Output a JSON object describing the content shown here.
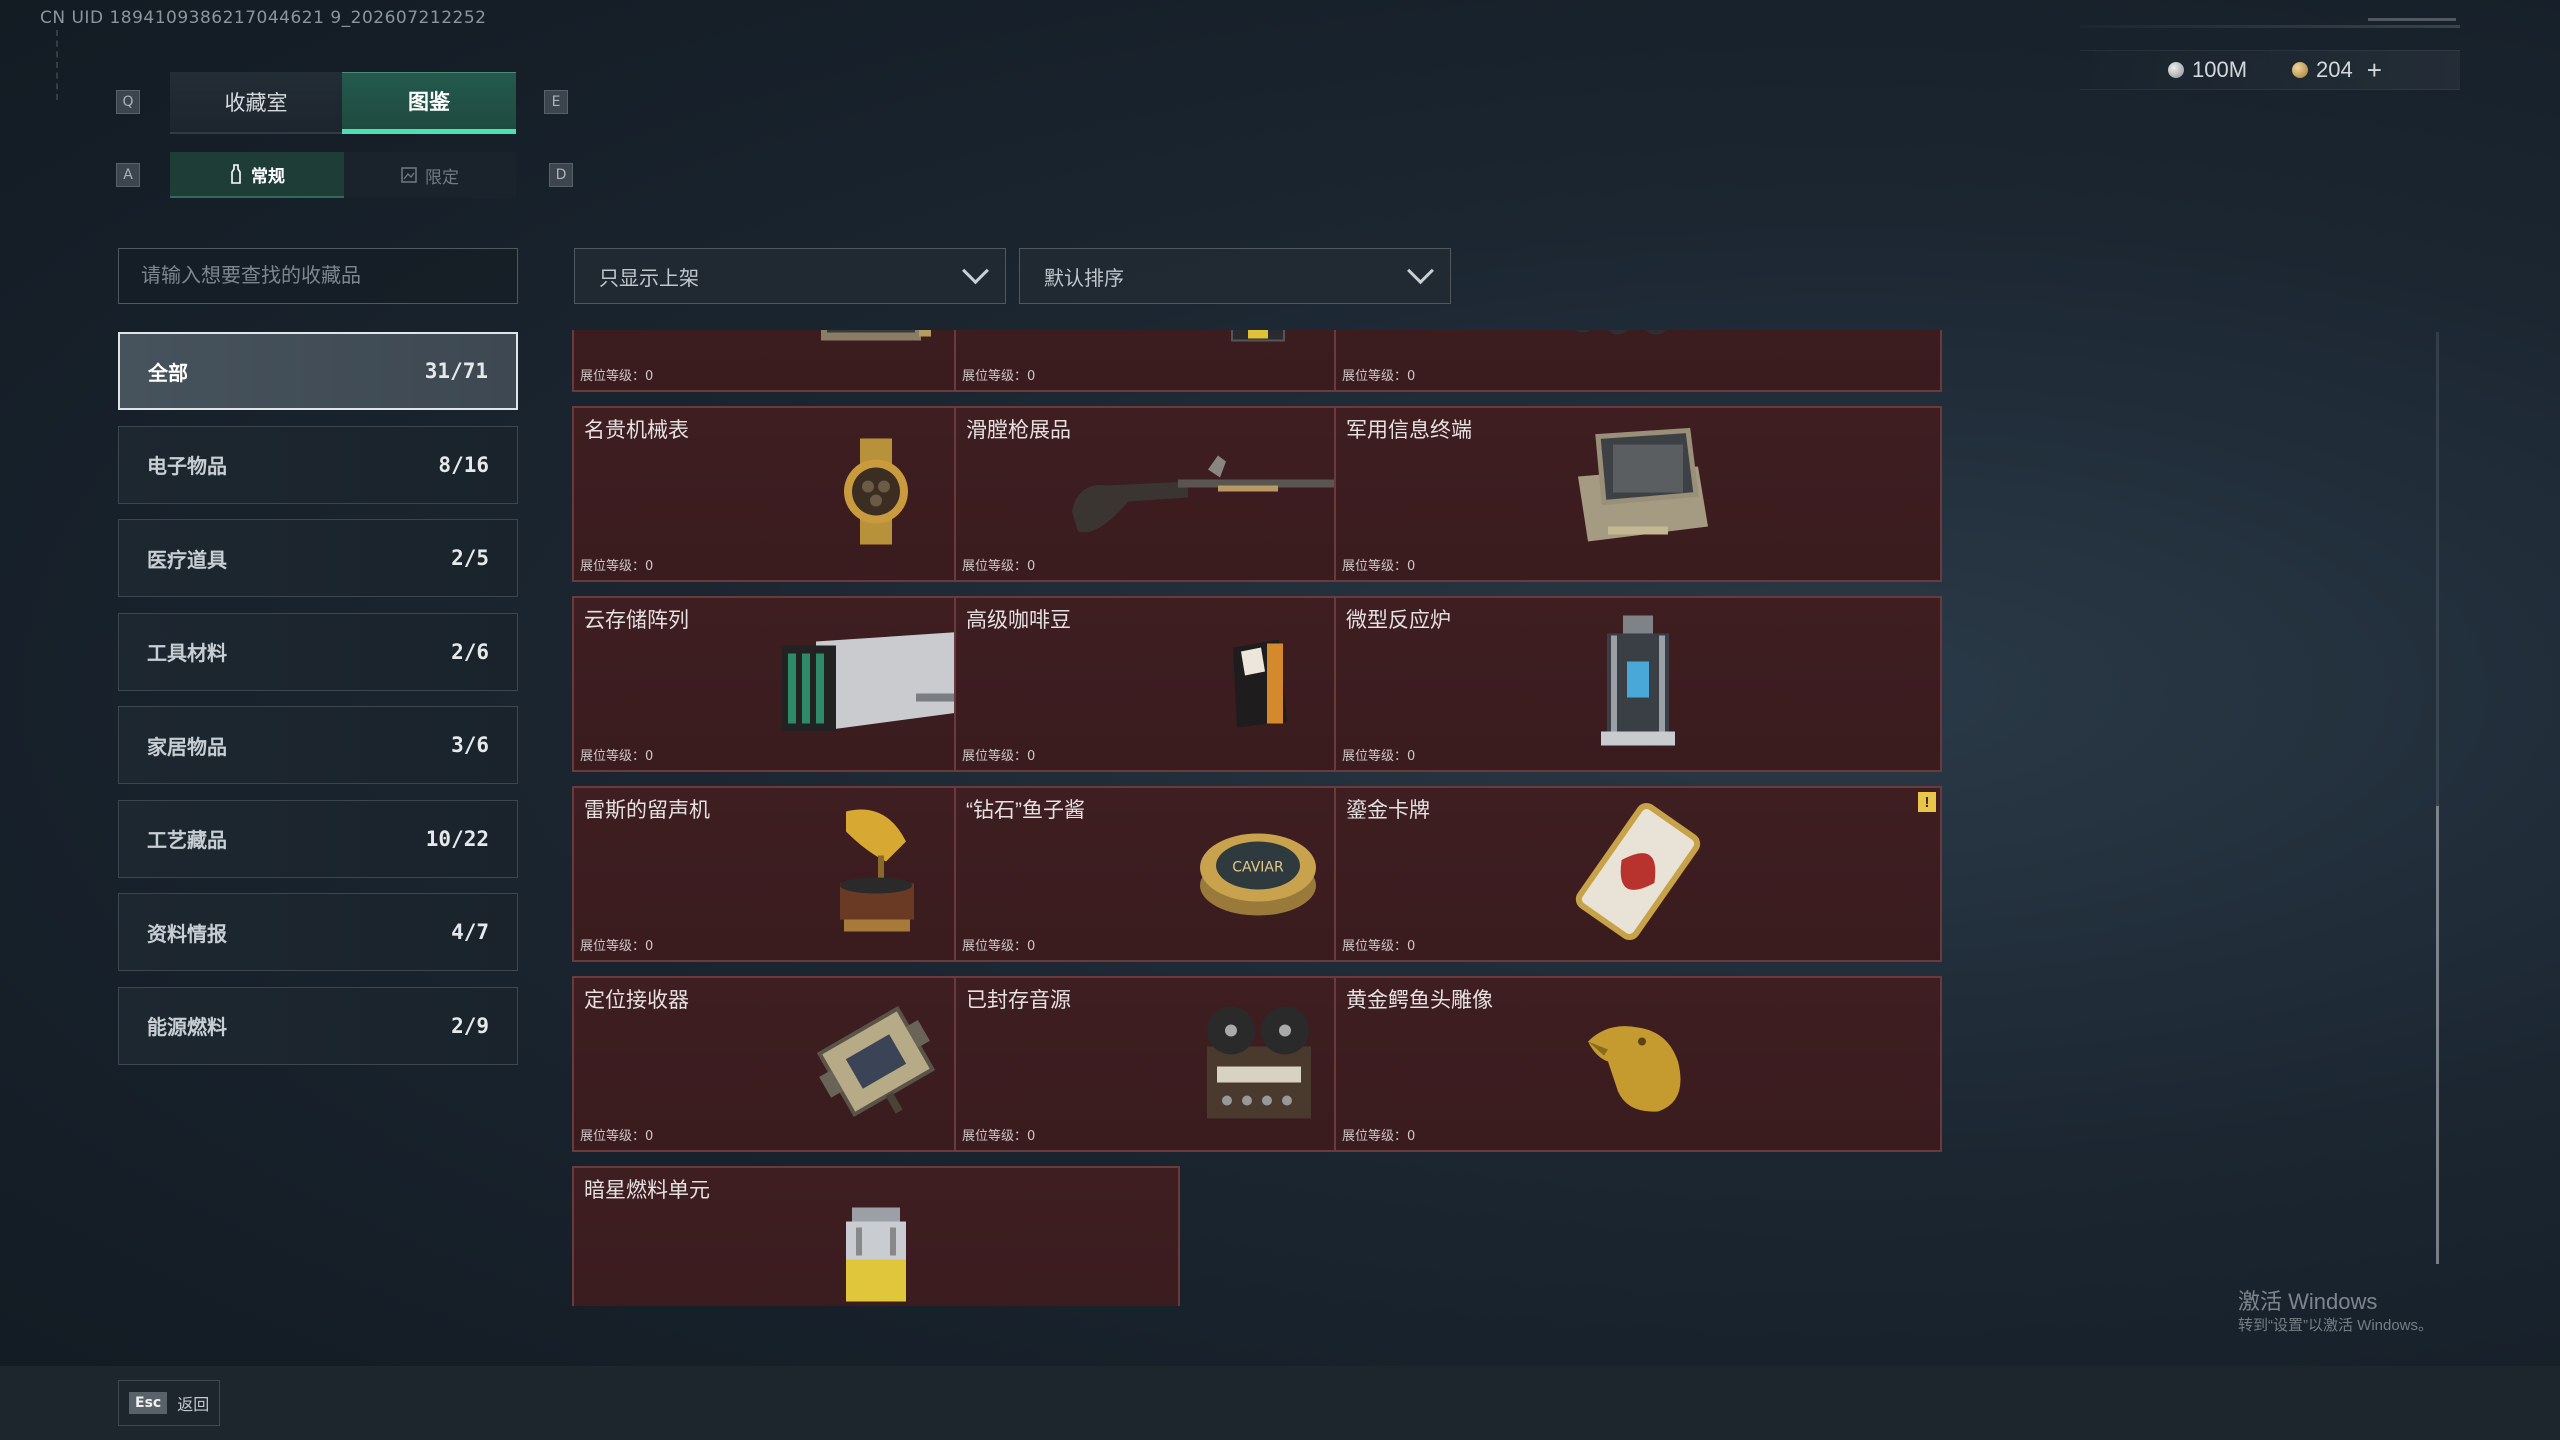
{
  "header": {
    "uid_text": "CN UID 1894109386217044621 9_202607212252",
    "key_q": "Q",
    "key_e": "E",
    "key_a": "A",
    "key_d": "D",
    "tabs": [
      "收藏室",
      "图鉴"
    ],
    "subtabs": [
      "常规",
      "限定"
    ],
    "currency": {
      "silver": "100M",
      "gold": "204",
      "add": "+"
    }
  },
  "filters": {
    "search_placeholder": "请输入想要查找的收藏品",
    "shelf_filter": "只显示上架",
    "sort": "默认排序"
  },
  "categories": [
    {
      "name": "全部",
      "count": "31/71",
      "active": true
    },
    {
      "name": "电子物品",
      "count": "8/16"
    },
    {
      "name": "医疗道具",
      "count": "2/5"
    },
    {
      "name": "工具材料",
      "count": "2/6"
    },
    {
      "name": "家居物品",
      "count": "3/6"
    },
    {
      "name": "工艺藏品",
      "count": "10/22"
    },
    {
      "name": "资料情报",
      "count": "4/7"
    },
    {
      "name": "能源燃料",
      "count": "2/9"
    }
  ],
  "level_label": "展位等级：0",
  "items": [
    {
      "title": "",
      "warn": false,
      "icon": "server-rack-icon"
    },
    {
      "title": "",
      "warn": false,
      "icon": "red-device-icon"
    },
    {
      "title": "",
      "warn": false,
      "icon": "armored-vehicle-icon"
    },
    {
      "title": "名贵机械表",
      "warn": true,
      "icon": "watch-icon"
    },
    {
      "title": "滑膛枪展品",
      "warn": true,
      "icon": "musket-icon"
    },
    {
      "title": "军用信息终端",
      "warn": false,
      "icon": "terminal-case-icon"
    },
    {
      "title": "云存储阵列",
      "warn": false,
      "icon": "storage-array-icon"
    },
    {
      "title": "高级咖啡豆",
      "warn": true,
      "icon": "coffee-bag-icon"
    },
    {
      "title": "微型反应炉",
      "warn": false,
      "icon": "reactor-icon"
    },
    {
      "title": "雷斯的留声机",
      "warn": false,
      "icon": "gramophone-icon"
    },
    {
      "title": "“钻石”鱼子酱",
      "warn": true,
      "icon": "caviar-tin-icon"
    },
    {
      "title": "鎏金卡牌",
      "warn": true,
      "icon": "gold-card-icon"
    },
    {
      "title": "定位接收器",
      "warn": false,
      "icon": "receiver-icon"
    },
    {
      "title": "已封存音源",
      "warn": false,
      "icon": "reel-recorder-icon"
    },
    {
      "title": "黄金鳄鱼头雕像",
      "warn": false,
      "icon": "croc-statue-icon"
    },
    {
      "title": "暗星燃料单元",
      "warn": false,
      "icon": "fuel-cell-icon"
    }
  ],
  "footer": {
    "esc_key": "Esc",
    "esc_label": "返回"
  },
  "watermark": {
    "line1": "激活 Windows",
    "line2": "转到“设置”以激活 Windows。"
  },
  "colors": {
    "accent": "#4ee0b0",
    "card_bg": "#3e1e21",
    "warn": "#e8c64a"
  }
}
